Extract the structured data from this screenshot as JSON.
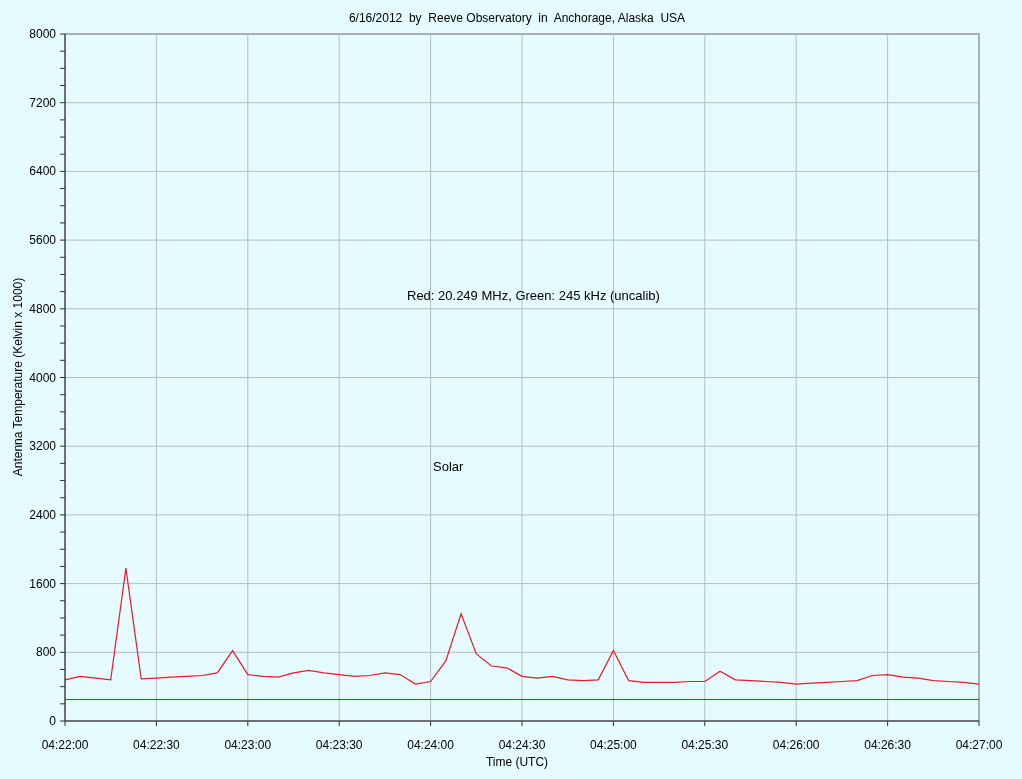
{
  "chart_data": {
    "type": "line",
    "title": "6/16/2012  by  Reeve Observatory  in  Anchorage, Alaska  USA",
    "xlabel": "Time (UTC)",
    "ylabel": "Antenna Temperature (Kelvin x 1000)",
    "ylim": [
      0,
      8000
    ],
    "grid": true,
    "categories": [
      "04:22:00",
      null,
      null,
      null,
      null,
      null,
      "04:22:30",
      null,
      null,
      null,
      null,
      null,
      "04:23:00",
      null,
      null,
      null,
      null,
      null,
      "04:23:30",
      null,
      null,
      null,
      null,
      null,
      "04:24:00",
      null,
      null,
      null,
      null,
      null,
      "04:24:30",
      null,
      null,
      null,
      null,
      null,
      "04:25:00",
      null,
      null,
      null,
      null,
      null,
      "04:25:30",
      null,
      null,
      null,
      null,
      null,
      "04:26:00",
      null,
      null,
      null,
      null,
      null,
      "04:26:30",
      null,
      null,
      null,
      null,
      null,
      "04:27:00"
    ],
    "series": [
      {
        "color": "#e8192c",
        "values": [
          480,
          520,
          500,
          480,
          1780,
          490,
          500,
          510,
          520,
          530,
          560,
          820,
          540,
          520,
          510,
          560,
          590,
          560,
          540,
          520,
          530,
          560,
          540,
          430,
          460,
          700,
          1250,
          780,
          640,
          620,
          520,
          500,
          520,
          480,
          470,
          480,
          820,
          470,
          450,
          450,
          450,
          460,
          460,
          580,
          480,
          470,
          460,
          450,
          430,
          440,
          450,
          460,
          470,
          530,
          540,
          510,
          500,
          470,
          460,
          450,
          430
        ]
      },
      {
        "color": "#1a7a1a",
        "values": [
          250,
          250,
          250,
          250,
          250,
          250,
          250,
          250,
          250,
          250,
          250,
          250,
          250,
          250,
          250,
          250,
          250,
          250,
          250,
          250,
          250,
          250,
          250,
          250,
          250,
          250,
          250,
          250,
          250,
          250,
          250,
          250,
          250,
          250,
          250,
          250,
          250,
          250,
          250,
          250,
          250,
          250,
          250,
          250,
          250,
          250,
          250,
          250,
          250,
          250,
          250,
          250,
          250,
          250,
          250,
          250,
          250,
          250,
          250,
          250,
          250
        ]
      }
    ],
    "yticks": [
      0,
      800,
      1600,
      2400,
      3200,
      4000,
      4800,
      5600,
      6400,
      7200,
      8000
    ],
    "annotations": [
      "Red: 20.249 MHz, Green: 245 kHz (uncalib)",
      "Solar"
    ]
  }
}
